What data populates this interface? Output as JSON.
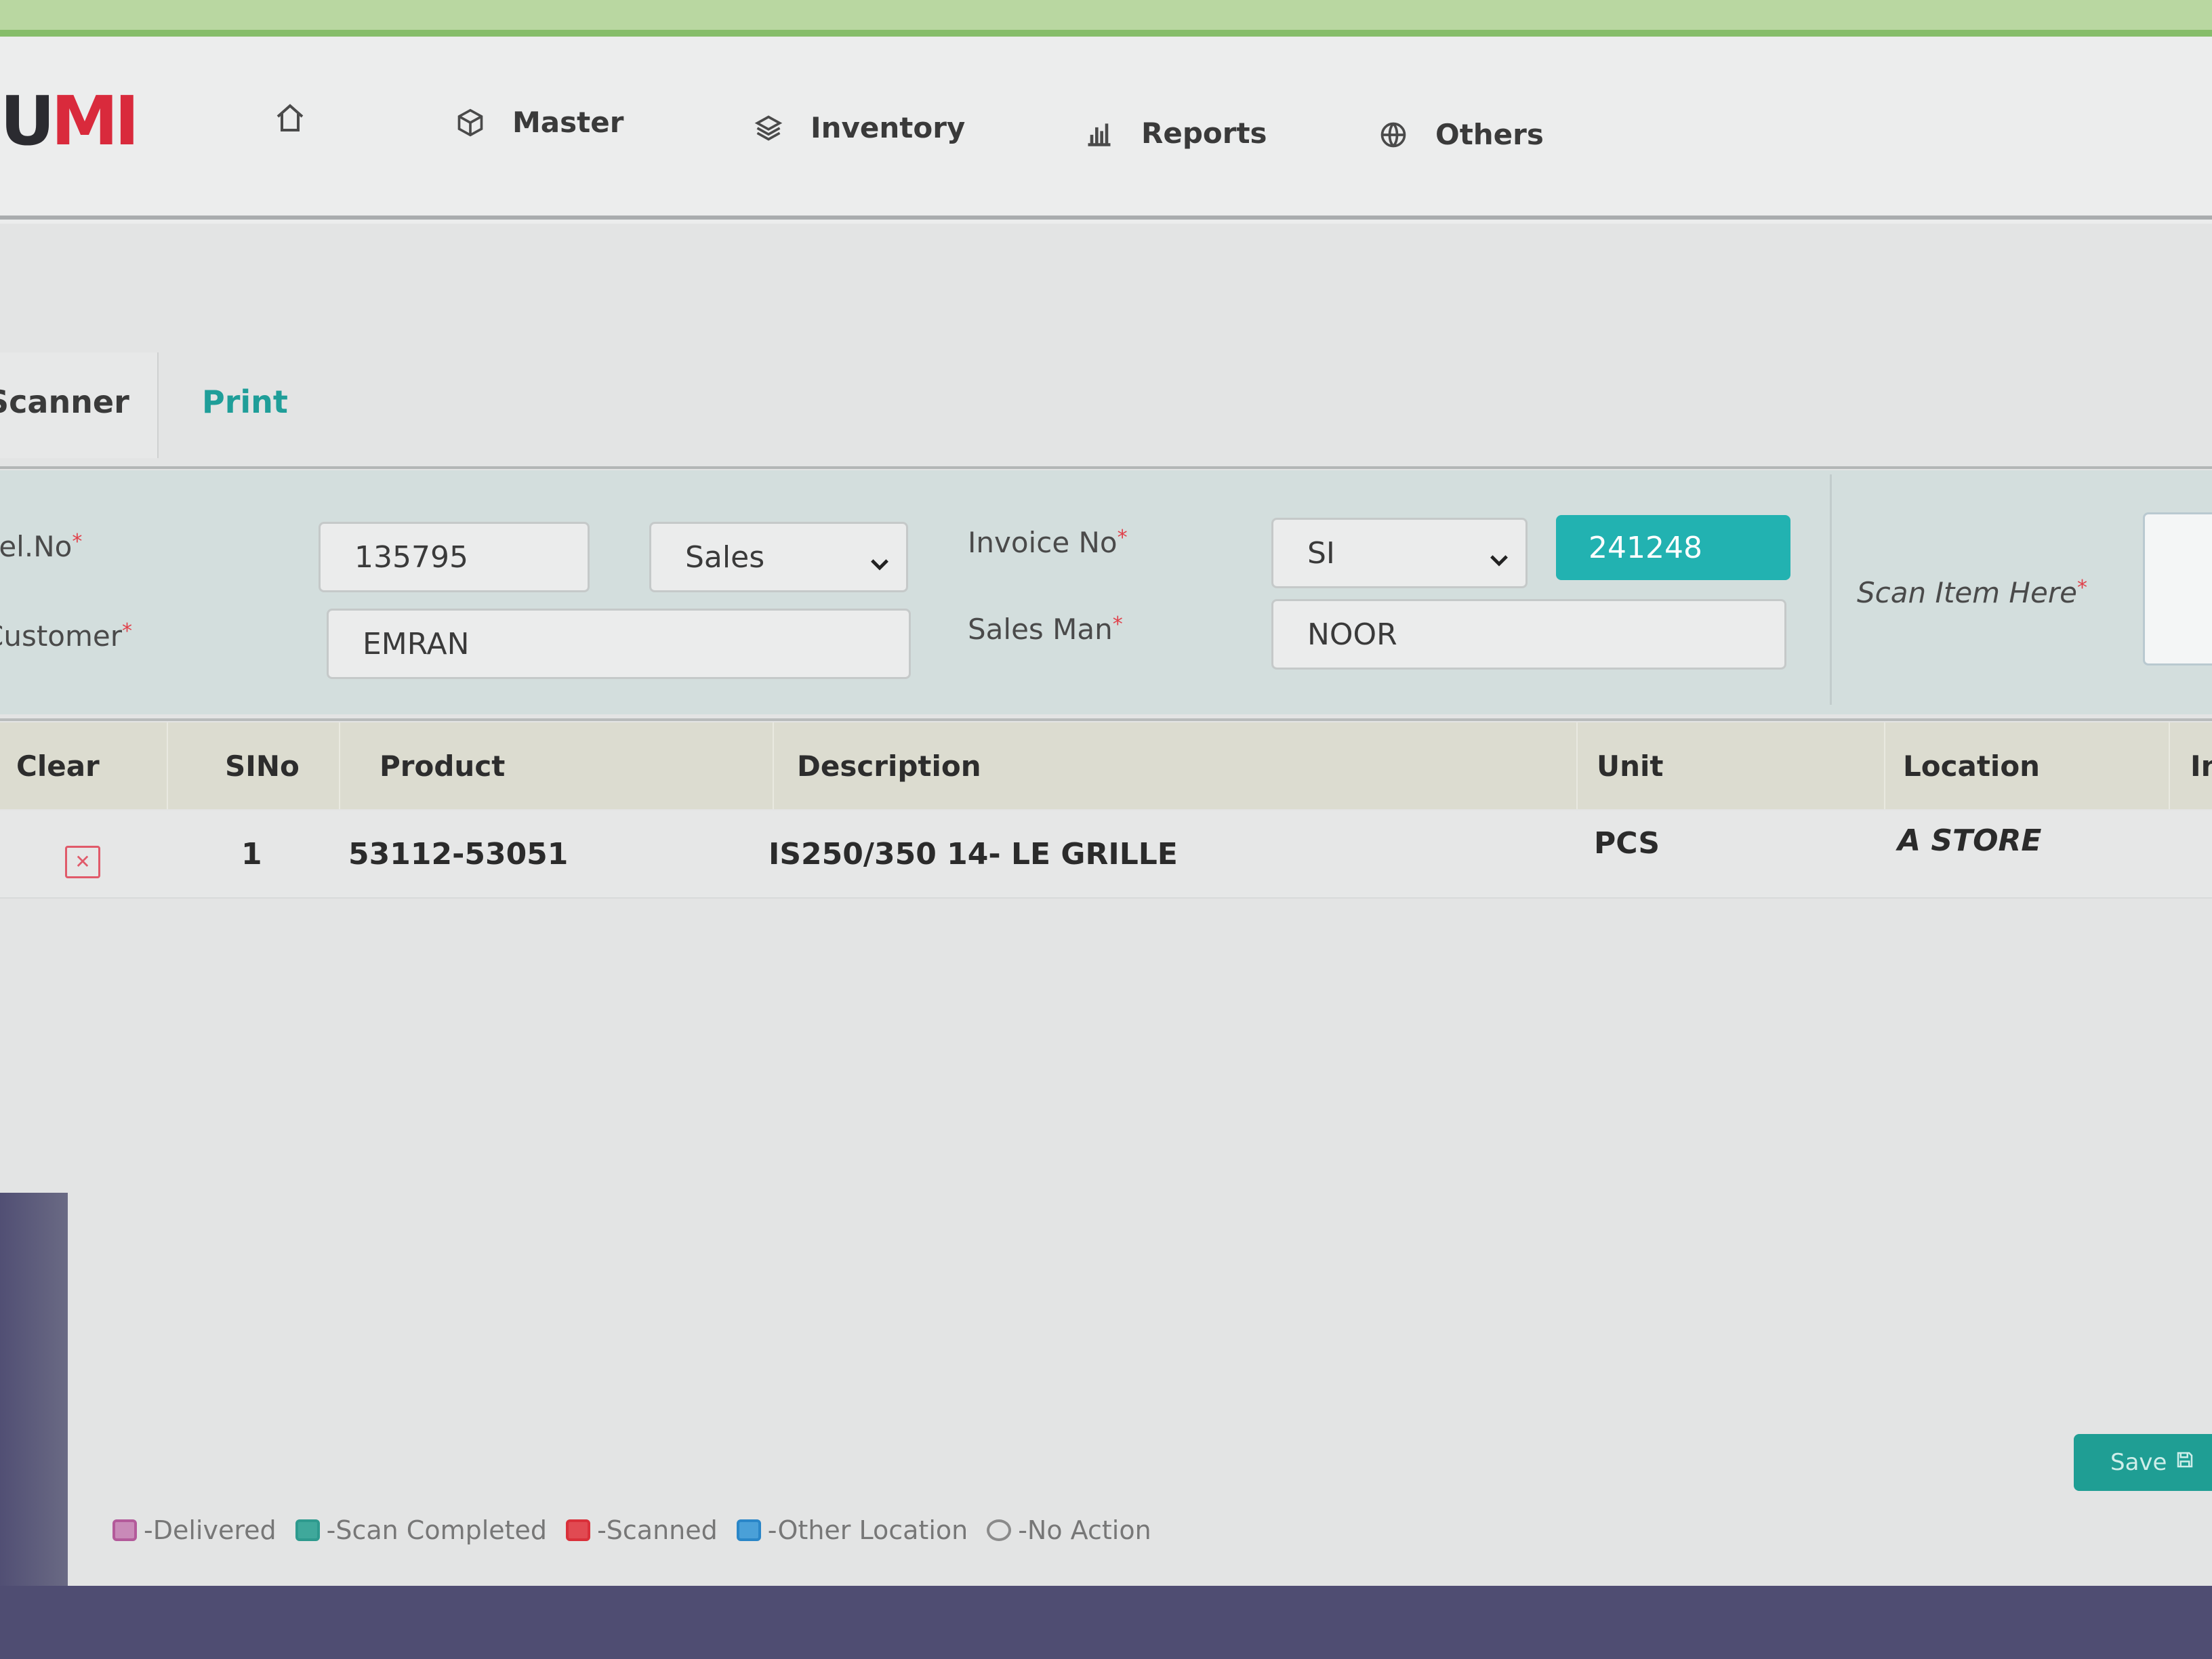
{
  "colors": {
    "accent": "#22b2b1",
    "brand_red": "#d92a3c",
    "header_green": "#86bd6a",
    "required": "#e0404a"
  },
  "app": {
    "logo_text_dark": "U",
    "logo_text_red": "MI"
  },
  "nav": {
    "home_icon": "home-icon",
    "items": [
      {
        "label": "Master",
        "icon": "cube-icon"
      },
      {
        "label": "Inventory",
        "icon": "layers-icon"
      },
      {
        "label": "Reports",
        "icon": "bar-chart-icon"
      },
      {
        "label": "Others",
        "icon": "globe-icon"
      }
    ]
  },
  "tabs": [
    {
      "label": "Scanner",
      "active": true
    },
    {
      "label": "Print",
      "active": false
    }
  ],
  "form": {
    "del_no_label": "Del.No",
    "del_no_value": "135795",
    "type_select_value": "Sales",
    "customer_label": "Customer",
    "customer_value": "EMRAN",
    "invoice_label": "Invoice No",
    "invoice_prefix_value": "SI",
    "invoice_number_value": "241248",
    "salesman_label": "Sales Man",
    "salesman_value": "NOOR",
    "scan_label": "Scan Item Here",
    "required_mark": "*"
  },
  "table": {
    "columns": [
      "Clear",
      "SINo",
      "Product",
      "Description",
      "Unit",
      "Location",
      "In"
    ],
    "rows": [
      {
        "sino": "1",
        "product": "53112-53051",
        "description": "IS250/350 14- LE GRILLE",
        "unit": "PCS",
        "location": "A STORE"
      }
    ],
    "delete_icon": "close-icon"
  },
  "legend": [
    {
      "label": "-Delivered",
      "color": "#b35a9a"
    },
    {
      "label": "-Scan Completed",
      "color": "#2e9a8e"
    },
    {
      "label": "-Scanned",
      "color": "#d9303a"
    },
    {
      "label": "-Other Location",
      "color": "#2a86c8"
    },
    {
      "label": "-No Action",
      "color": "none"
    }
  ],
  "footer": {
    "save_label": "Save",
    "save_icon": "save-icon"
  }
}
